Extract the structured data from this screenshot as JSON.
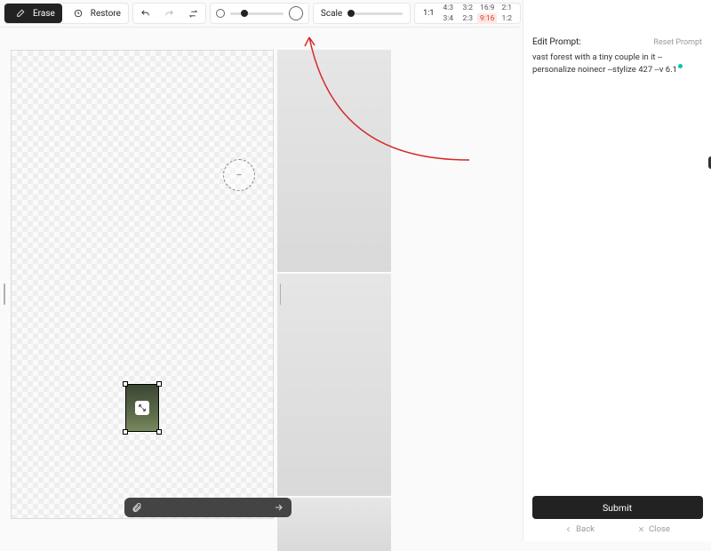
{
  "toolbar": {
    "erase_label": "Erase",
    "restore_label": "Restore",
    "scale_label": "Scale",
    "brush_value": 0.25
  },
  "ratios": {
    "primary": "1:1",
    "grid": [
      "4:3",
      "3:2",
      "16:9",
      "2:1",
      "3:4",
      "2:3",
      "9:16",
      "1:2"
    ],
    "active": "9:16"
  },
  "icons": {
    "erase": "erase-icon",
    "restore": "restore-icon",
    "undo": "undo-icon",
    "redo": "redo-icon",
    "swap": "swap-icon",
    "chevron_left": "chevron-left-icon",
    "close": "close-icon",
    "attach": "paperclip-icon",
    "send": "send-icon",
    "move": "expand-icon",
    "minus": "minus-icon"
  },
  "canvas": {
    "brush_cursor_symbol": "−"
  },
  "panel": {
    "edit_label": "Edit Prompt:",
    "reset_label": "Reset Prompt",
    "prompt_text": "vast forest with a tiny couple in it  --personalize noinecr --stylize 427 --v 6.1",
    "submit_label": "Submit",
    "back_label": "Back",
    "close_label": "Close"
  },
  "colors": {
    "accent_red": "#ef3b2c",
    "highlight_bg": "#ffe7e3",
    "dark": "#222222"
  }
}
